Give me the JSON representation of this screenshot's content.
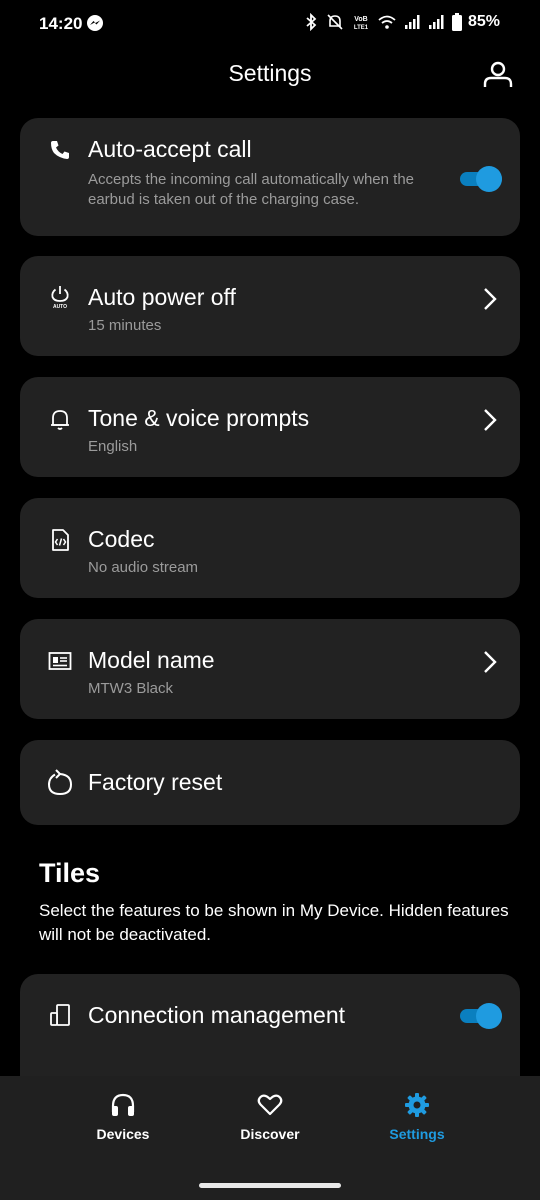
{
  "status_bar": {
    "time": "14:20",
    "battery": "85%"
  },
  "header": {
    "title": "Settings"
  },
  "settings": [
    {
      "label": "Auto-accept call",
      "description": "Accepts the incoming call automatically when the earbud is taken out of the charging case.",
      "icon": "phone-icon",
      "toggle": true
    },
    {
      "label": "Auto power off",
      "value": "15 minutes",
      "icon": "power-auto-icon",
      "chevron": true
    },
    {
      "label": "Tone & voice prompts",
      "value": "English",
      "icon": "bell-icon",
      "chevron": true
    },
    {
      "label": "Codec",
      "value": "No audio stream",
      "icon": "code-file-icon"
    },
    {
      "label": "Model name",
      "value": "MTW3 Black",
      "icon": "id-card-icon",
      "chevron": true
    },
    {
      "label": "Factory reset",
      "icon": "reset-icon"
    }
  ],
  "tiles": {
    "title": "Tiles",
    "description": "Select the features to be shown in My Device. Hidden features will not be deactivated.",
    "items": [
      {
        "label": "Connection management",
        "icon": "devices-icon",
        "toggle": true
      }
    ]
  },
  "bottom_nav": {
    "items": [
      {
        "label": "Devices",
        "icon": "headphones-icon",
        "active": false
      },
      {
        "label": "Discover",
        "icon": "heart-icon",
        "active": false
      },
      {
        "label": "Settings",
        "icon": "gear-icon",
        "active": true
      }
    ]
  },
  "colors": {
    "accent": "#1f9be0",
    "card": "#222222",
    "background": "#000000",
    "nav": "#202020"
  }
}
